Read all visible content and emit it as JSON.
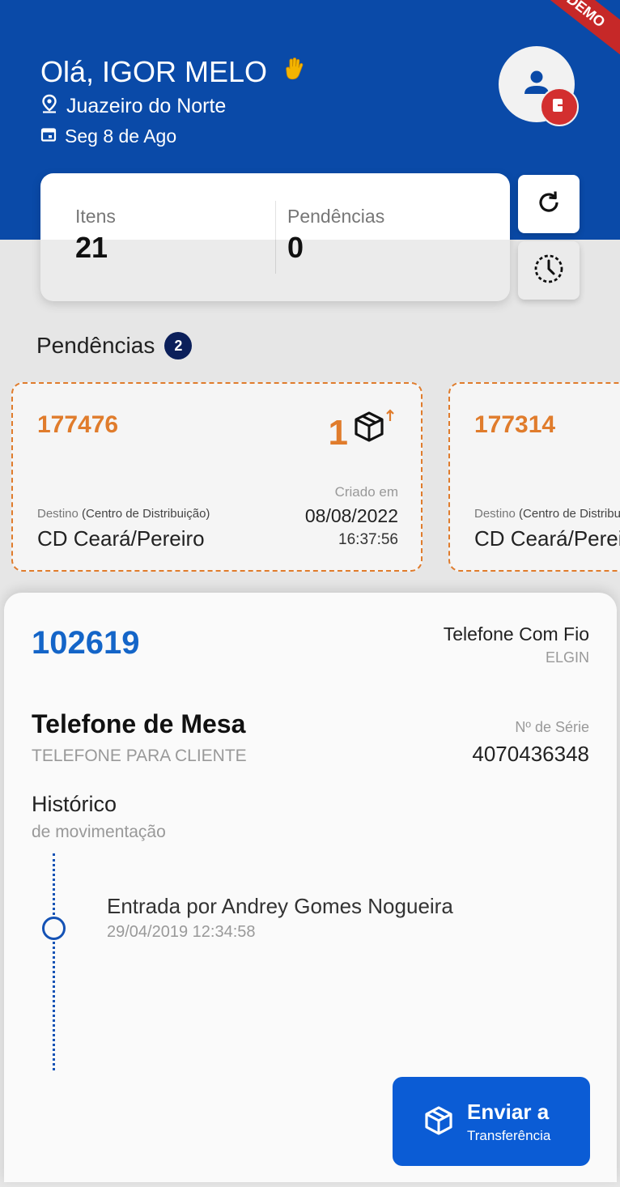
{
  "ribbon": "DEMO",
  "header": {
    "greeting": "Olá, IGOR MELO",
    "city": "Juazeiro do Norte",
    "date": "Seg 8 de Ago"
  },
  "stats": {
    "items_label": "Itens",
    "items_value": "21",
    "pending_label": "Pendências",
    "pending_value": "0"
  },
  "pending_section": {
    "title": "Pendências",
    "count": "2",
    "cards": [
      {
        "id": "177476",
        "count": "1",
        "dest_label_prefix": "Destino",
        "dest_label_suffix": "(Centro de Distribuição)",
        "dest": "CD Ceará/Pereiro",
        "created_label": "Criado em",
        "created_date": "08/08/2022",
        "created_time": "16:37:56"
      },
      {
        "id": "177314",
        "dest_label_prefix": "Destino",
        "dest_label_suffix": "(Centro de Distribuição)",
        "dest": "CD Ceará/Pereiro"
      }
    ]
  },
  "detail": {
    "code": "102619",
    "product_type": "Telefone Com Fio",
    "brand": "ELGIN",
    "name": "Telefone de Mesa",
    "category": "TELEFONE PARA CLIENTE",
    "serial_label": "Nº de Série",
    "serial_value": "4070436348",
    "history_title": "Histórico",
    "history_subtitle": "de movimentação",
    "events": [
      {
        "text": "Entrada por Andrey Gomes Nogueira",
        "datetime": "29/04/2019 12:34:58"
      }
    ],
    "send_button": {
      "title": "Enviar a",
      "subtitle": "Transferência"
    }
  }
}
